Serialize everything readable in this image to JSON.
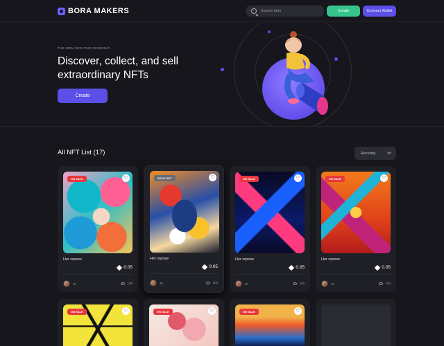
{
  "header": {
    "brand": "BORA MAKERS",
    "search_placeholder": "Search item",
    "create_label": "Create",
    "wallet_label": "Connect Wallet"
  },
  "hero": {
    "eyebrow": "THE NEW CREATIVE ECONOMY.",
    "title": "Discover, collect, and sell extraordinary NFTs",
    "button_label": "Create"
  },
  "list": {
    "title": "All NFT List (17)",
    "sort_label": "Recently",
    "cards": [
      {
        "badge": "ON SALE",
        "name": "Her repose",
        "price": "0.05",
        "user": "JK",
        "views": "100"
      },
      {
        "badge": "SOLD OUT",
        "name": "Her repose",
        "price": "0.05",
        "user": "JK",
        "views": "100"
      },
      {
        "badge": "ON SALE",
        "name": "Her repose",
        "price": "0.05",
        "user": "JK",
        "views": "100"
      },
      {
        "badge": "ON SALE",
        "name": "Her repose",
        "price": "0.05",
        "user": "JK",
        "views": "100"
      },
      {
        "badge": "ON SALE"
      },
      {
        "badge": "ON SALE"
      },
      {
        "badge": "ON SALE"
      },
      {}
    ]
  },
  "colors": {
    "accent": "#5b4fe8",
    "create_green": "#36c48c",
    "sale_red": "#e8383d",
    "background": "#16161c"
  }
}
